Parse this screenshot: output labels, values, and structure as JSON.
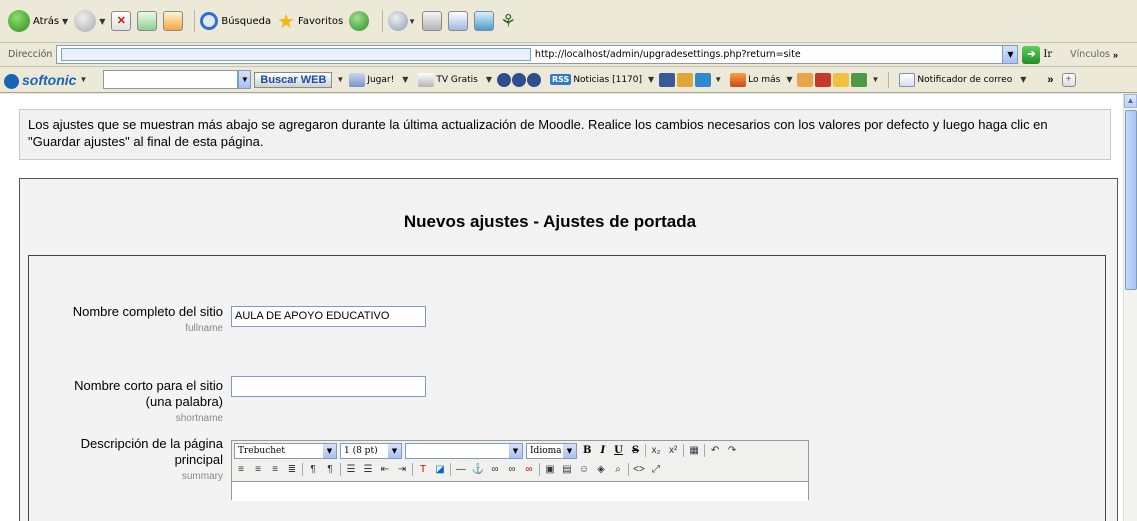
{
  "toolbar": {
    "back_label": "Atrás",
    "search_label": "Búsqueda",
    "favorites_label": "Favoritos"
  },
  "address": {
    "label": "Dirección",
    "url": "http://localhost/admin/upgradesettings.php?return=site",
    "go_label": "Ir",
    "links_label": "Vínculos"
  },
  "softonic": {
    "logo": "softonic",
    "search_button": "Buscar WEB",
    "items": {
      "jugar": "Jugar!",
      "tv": "TV Gratis",
      "rss": "RSS",
      "noticias": "Noticias [1170]",
      "lomas": "Lo más",
      "notificador": "Notificador de correo"
    }
  },
  "page": {
    "notice": "Los ajustes que se muestran más abajo se agregaron durante la última actualización de Moodle. Realice los cambios necesarios con los valores por defecto y luego haga clic en \"Guardar ajustes\" al final de esta página.",
    "form_title": "Nuevos ajustes - Ajustes de portada",
    "fields": {
      "fullname": {
        "label": "Nombre completo del sitio",
        "key": "fullname",
        "value": "AULA DE APOYO EDUCATIVO"
      },
      "shortname": {
        "label_line1": "Nombre corto para el sitio",
        "label_line2": "(una palabra)",
        "key": "shortname",
        "value": ""
      },
      "summary": {
        "label_line1": "Descripción de la página",
        "label_line2": "principal",
        "key": "summary"
      }
    },
    "editor": {
      "font": "Trebuchet",
      "size": "1 (8 pt)",
      "format": "",
      "language": "Idioma"
    }
  },
  "colors": {
    "chrome": "#ece9d8",
    "accent": "#1a64b4"
  }
}
